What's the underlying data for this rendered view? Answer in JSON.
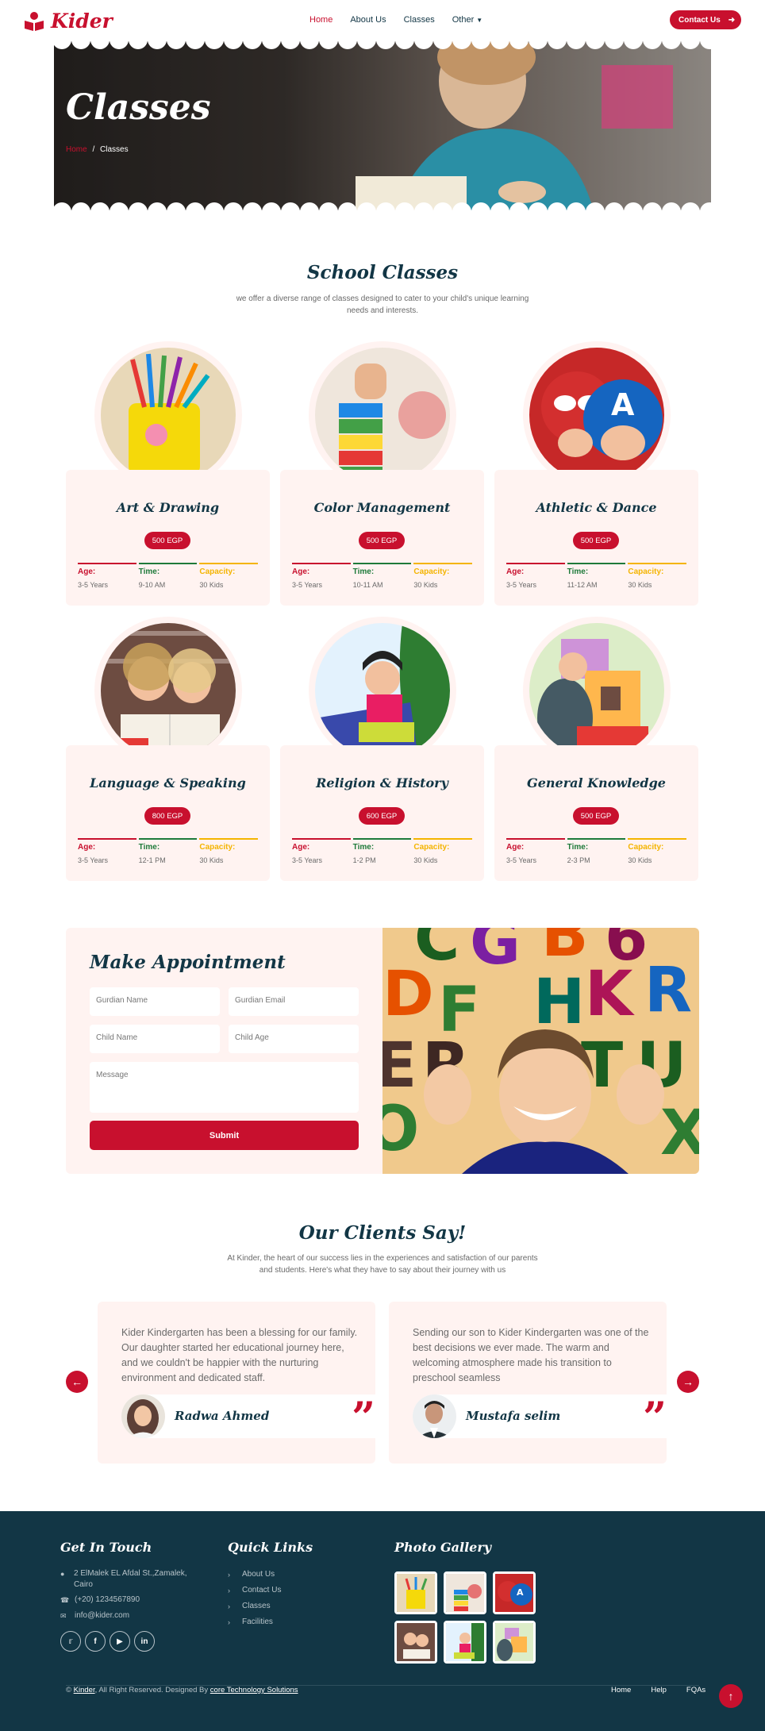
{
  "nav": {
    "brand": "Kider",
    "menu": [
      {
        "label": "Home"
      },
      {
        "label": "About Us"
      },
      {
        "label": "Classes"
      },
      {
        "label": "Other"
      }
    ],
    "contact_label": "Contact Us"
  },
  "hero": {
    "title": "Classes",
    "crumb_home": "Home",
    "crumb_sep": "/",
    "crumb_current": "Classes"
  },
  "classes": {
    "title": "School Classes",
    "subtitle": "we offer a diverse range of classes designed to cater to your child's unique learning needs and interests.",
    "age_label": "Age:",
    "time_label": "Time:",
    "capacity_label": "Capacity:",
    "items": [
      {
        "name": "Art & Drawing",
        "price": "500 EGP",
        "age": "3-5 Years",
        "time": "9-10 AM",
        "capacity": "30 Kids"
      },
      {
        "name": "Color Management",
        "price": "500 EGP",
        "age": "3-5 Years",
        "time": "10-11 AM",
        "capacity": "30 Kids"
      },
      {
        "name": "Athletic & Dance",
        "price": "500 EGP",
        "age": "3-5 Years",
        "time": "11-12 AM",
        "capacity": "30 Kids"
      },
      {
        "name": "Language & Speaking",
        "price": "800 EGP",
        "age": "3-5 Years",
        "time": "12-1 PM",
        "capacity": "30 Kids"
      },
      {
        "name": "Religion & History",
        "price": "600 EGP",
        "age": "3-5 Years",
        "time": "1-2 PM",
        "capacity": "30 Kids"
      },
      {
        "name": "General Knowledge",
        "price": "500 EGP",
        "age": "3-5 Years",
        "time": "2-3 PM",
        "capacity": "30 Kids"
      }
    ]
  },
  "appointment": {
    "title": "Make Appointment",
    "guardian_name": "Gurdian Name",
    "guardian_email": "Gurdian Email",
    "child_name": "Child Name",
    "child_age": "Child Age",
    "message": "Message",
    "submit": "Submit"
  },
  "testimonials": {
    "title": "Our Clients Say!",
    "subtitle": "At Kinder, the heart of our success lies in the experiences and satisfaction of our parents and students. Here's what they have to say about their journey with us",
    "items": [
      {
        "text": "Kider Kindergarten has been a blessing for our family. Our daughter started her educational journey here, and we couldn't be happier with the nurturing environment and dedicated staff.",
        "name": "Radwa Ahmed"
      },
      {
        "text": "Sending our son to Kider Kindergarten was one of the best decisions we ever made. The warm and welcoming atmosphere made his transition to preschool seamless",
        "name": "Mustafa selim"
      }
    ],
    "quote_mark": "”"
  },
  "footer": {
    "touch_title": "Get In Touch",
    "address": "2 ElMalek EL Afdal St.,Zamalek, Cairo",
    "phone": "(+20) 1234567890",
    "email": "info@kider.com",
    "links_title": "Quick Links",
    "links": [
      {
        "label": "About Us"
      },
      {
        "label": "Contact Us"
      },
      {
        "label": "Classes"
      },
      {
        "label": "Facilities"
      }
    ],
    "gallery_title": "Photo Gallery",
    "copy_prefix": "©",
    "copy_brand": "Kinder",
    "copy_mid": ", All Right Reserved. Designed By",
    "copy_designer": "core Technology Solutions",
    "bottom_links": [
      {
        "label": "Home"
      },
      {
        "label": "Help"
      },
      {
        "label": "FQAs"
      }
    ]
  },
  "colors": {
    "brand": "#c8102e",
    "dark": "#123645",
    "card_bg": "#fff3f1",
    "green": "#1e7a3a",
    "yellow": "#f4b400"
  }
}
